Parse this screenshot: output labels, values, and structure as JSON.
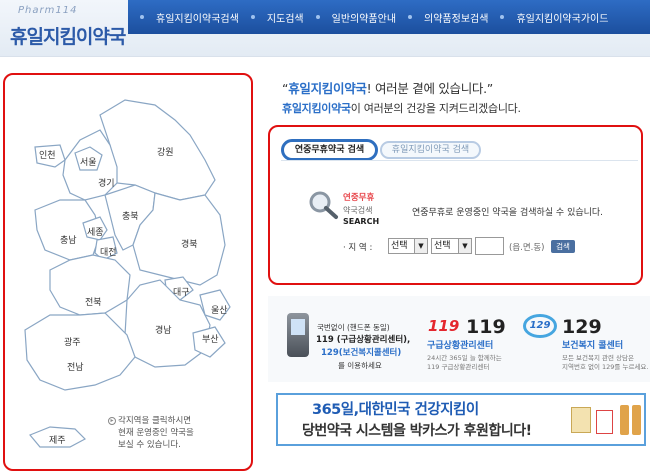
{
  "header": {
    "logo_sub": "Pharm114",
    "logo_main": "휴일지킴이약국",
    "nav": [
      "휴일지킴이약국검색",
      "지도검색",
      "일반의약품안내",
      "의약품정보검색",
      "휴일지킴이약국가이드"
    ]
  },
  "map": {
    "regions": [
      "인천",
      "서울",
      "경기",
      "강원",
      "충북",
      "충남",
      "세종",
      "대전",
      "경북",
      "대구",
      "전북",
      "울산",
      "경남",
      "부산",
      "광주",
      "전남",
      "제주"
    ],
    "note": [
      "각지역을 클릭하시면",
      "현재 운영중인 약국을",
      "보실 수 있습니다."
    ]
  },
  "slogan": {
    "line1_quote_open": "“",
    "line1_brand": "휴일지킴이약국",
    "line1_rest": "! 여러분 곁에 있습니다.”",
    "line2_brand": "휴일지킴이약국",
    "line2_rest": "이 여러분의 건강을 지켜드리겠습니다."
  },
  "search": {
    "tab_active": "연중무휴약국 검색",
    "tab_inactive": "휴일지킴이약국 검색",
    "title": "연중무휴",
    "sub1": "약국검색",
    "sub2": "SEARCH",
    "desc": "연중무휴로 운영중인 약국을 검색하실 수 있습니다.",
    "region_label": "· 지 역 :",
    "select1": "선택",
    "select2": "선택",
    "dong_hint": "(읍.면.동)",
    "button": "검색"
  },
  "banners": {
    "b1": [
      "국번없이 (핸드폰 동일)",
      "119 (구급상황관리센터),",
      "129(보건복지콜센터)",
      "를 이용하세요"
    ],
    "b2_logo": "119",
    "b2_num": "119",
    "b2": [
      "구급상황관리센터",
      "24시간 365일 늘 함께하는",
      "119 구급상황관리센터"
    ],
    "b3_logo": "129",
    "b3_num": "129",
    "b3": [
      "보건복지 콜센터",
      "모든 보건복지 관련 상담은",
      "지역번호 없이 129를 누르세요."
    ]
  },
  "bottom_banner": {
    "line1": "365일,대한민국 건강지킴이",
    "line2": "당번약국 시스템을 박카스가 후원합니다!"
  },
  "colors": {
    "accent": "#2b6fc8",
    "nav": "#1c4f9e",
    "highlight_border": "#e01010"
  }
}
